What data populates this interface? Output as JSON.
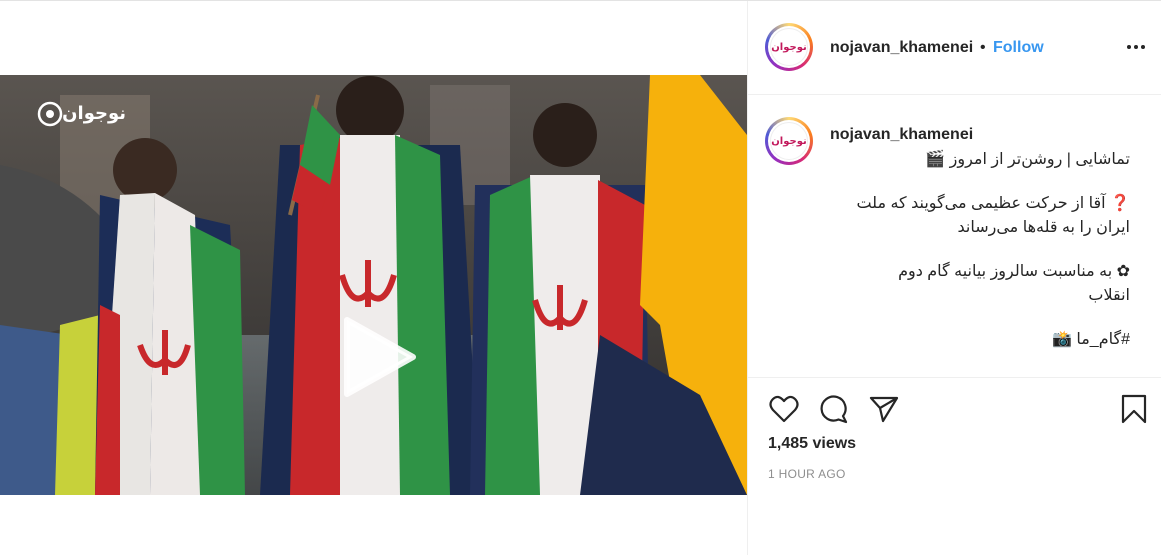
{
  "post": {
    "username": "nojavan_khamenei",
    "dot": "•",
    "follow_label": "Follow",
    "more_icon": "more-horizontal-icon",
    "avatar_text": "نوجوان"
  },
  "caption": {
    "username": "nojavan_khamenei",
    "line1": "تماشایی | روشن‌تر از امروز 🎬",
    "line2": "❓ آقا از حرکت عظیمی می‌گویند که ملت",
    "line3": "ایران را به قله‌ها می‌رساند",
    "line4": "✿ به مناسبت سالروز بیانیه گام دوم",
    "line5": "انقلاب",
    "line6": "#گام_ما 📸"
  },
  "video": {
    "watermark": "نوجوان",
    "play_icon": "play-icon",
    "tag_icon": "user-tag-icon"
  },
  "actions": {
    "like_icon": "heart-icon",
    "comment_icon": "comment-icon",
    "share_icon": "send-icon",
    "save_icon": "bookmark-icon"
  },
  "stats": {
    "views": "1,485 views",
    "time": "1 HOUR AGO"
  },
  "colors": {
    "link": "#3897f0",
    "text": "#262626",
    "muted": "#8e8e8e",
    "border": "#efefef"
  }
}
